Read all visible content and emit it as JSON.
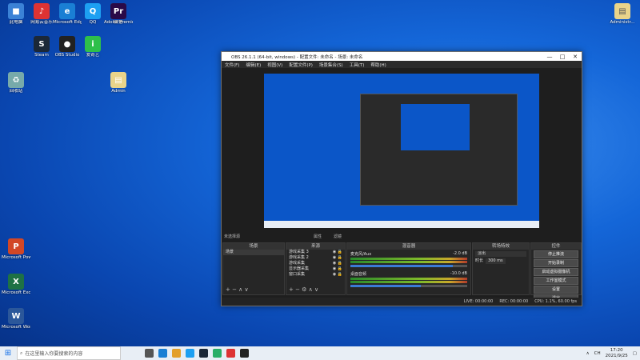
{
  "desktop": {
    "icons": [
      {
        "label": "此电脑",
        "color": "#3b82d6",
        "glyph": "■"
      },
      {
        "label": "网易云音乐",
        "color": "#d33",
        "glyph": "♪"
      },
      {
        "label": "Microsoft Edge",
        "color": "#1a7fd4",
        "glyph": "e"
      },
      {
        "label": "QQ",
        "color": "#1da0f2",
        "glyph": "Q"
      },
      {
        "label": "微信",
        "color": "#2aae67",
        "glyph": "W"
      },
      {
        "label": "Microsoft PowerPoint",
        "color": "#d24726",
        "glyph": "P"
      },
      {
        "label": "Microsoft Excel",
        "color": "#1e7145",
        "glyph": "X"
      },
      {
        "label": "Microsoft Word",
        "color": "#2b579a",
        "glyph": "W"
      },
      {
        "label": "Adobe Premiere",
        "color": "#2a0a48",
        "glyph": "Pr"
      },
      {
        "label": "回收站",
        "color": "#7aa",
        "glyph": "♻"
      },
      {
        "label": "Steam",
        "color": "#1b2838",
        "glyph": "S"
      },
      {
        "label": "OBS Studio",
        "color": "#222",
        "glyph": "●"
      },
      {
        "label": "爱奇艺",
        "color": "#2ec04a",
        "glyph": "i"
      },
      {
        "label": "Admin",
        "color": "#e9d48a",
        "glyph": "▤"
      }
    ],
    "user_icon_label": "Administr..."
  },
  "obs": {
    "title": "OBS 26.1.1 (64-bit, windows) - 配置文件: 未命名 - 场景: 未命名",
    "menu": [
      "文件(F)",
      "编辑(E)",
      "视图(V)",
      "配置文件(P)",
      "场景集合(S)",
      "工具(T)",
      "帮助(H)"
    ],
    "source_status": "未选择源",
    "ctrl_props": "属性",
    "ctrl_filters": "滤镜",
    "docks": {
      "scenes": {
        "title": "场景",
        "items": [
          "场景"
        ]
      },
      "sources": {
        "title": "来源",
        "items": [
          "游戏采集 3",
          "游戏采集 2",
          "游戏采集",
          "显示器采集",
          "窗口采集"
        ]
      },
      "mixer": {
        "title": "混音器",
        "channels": [
          {
            "name": "麦克风/Aux",
            "db": "-2.0 dB"
          },
          {
            "name": "桌面音频",
            "db": "-10.0 dB"
          }
        ]
      },
      "transitions": {
        "title": "转场特效",
        "mode": "淡出",
        "duration_label": "时长",
        "duration_value": "300 ms"
      },
      "controls": {
        "title": "控件",
        "buttons": [
          "停止推流",
          "开始录制",
          "启动虚拟摄像机",
          "工作室模式",
          "设置",
          "退出"
        ]
      }
    },
    "status_bar": {
      "live": "LIVE: 00:00:00",
      "rec": "REC: 00:00:00",
      "cpu": "CPU: 1.1%, 60.00 fps"
    }
  },
  "taskbar": {
    "search_placeholder": "在这里输入你要搜索的内容",
    "time": "17:20",
    "date": "2021/9/25",
    "lang": "CH"
  }
}
